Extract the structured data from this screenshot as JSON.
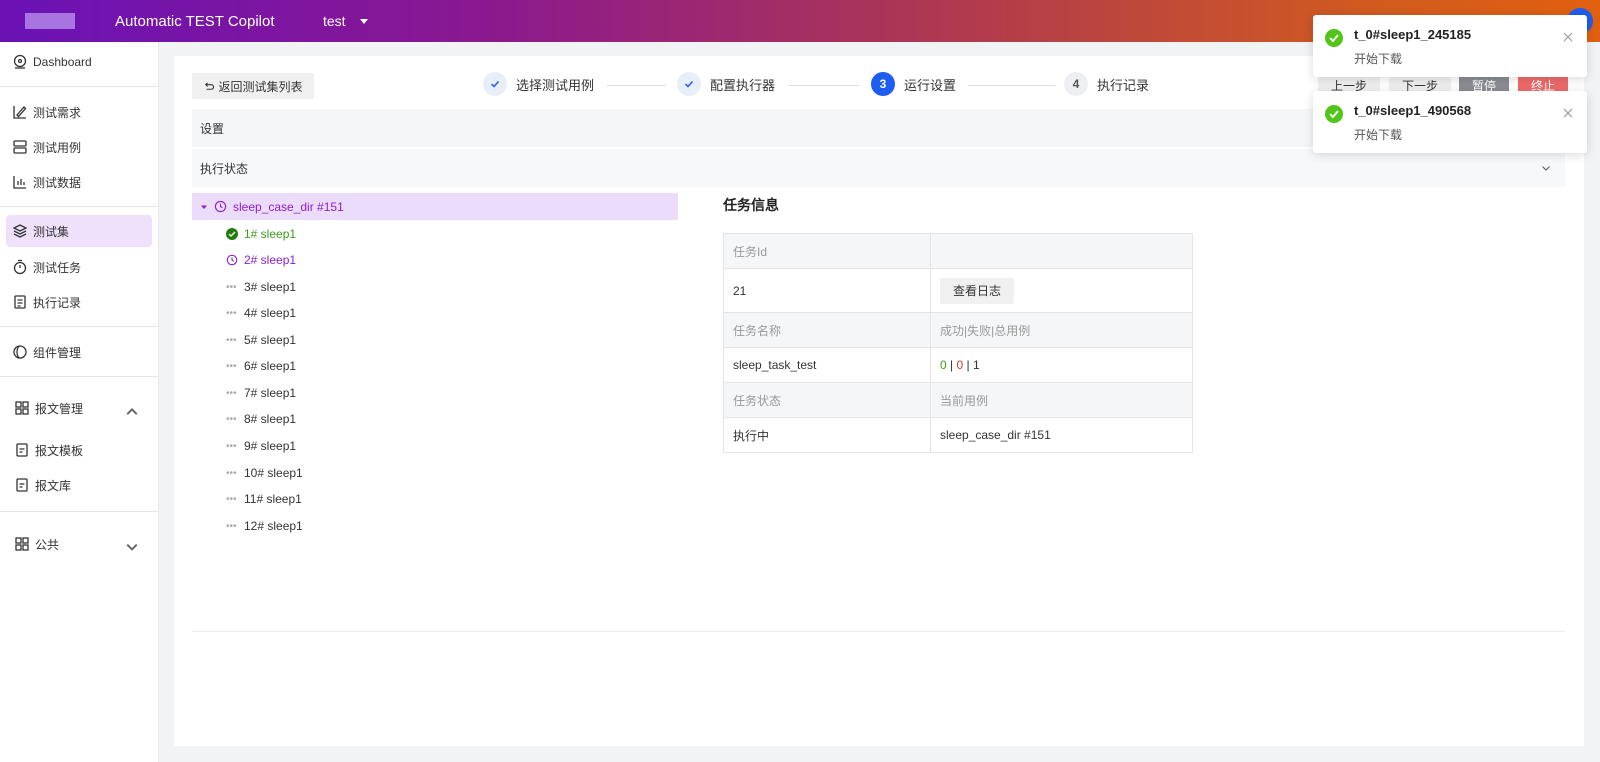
{
  "header": {
    "app_title": "Automatic TEST Copilot",
    "project": "test"
  },
  "sidebar": {
    "items": [
      {
        "label": "Dashboard",
        "icon": "dashboard-icon"
      },
      {
        "label": "测试需求",
        "icon": "requirement-icon"
      },
      {
        "label": "测试用例",
        "icon": "case-icon"
      },
      {
        "label": "测试数据",
        "icon": "data-icon"
      },
      {
        "label": "测试集",
        "icon": "layers-icon"
      },
      {
        "label": "测试任务",
        "icon": "timer-icon"
      },
      {
        "label": "执行记录",
        "icon": "record-icon"
      },
      {
        "label": "组件管理",
        "icon": "component-icon"
      },
      {
        "label": "报文管理",
        "icon": "grid-icon"
      },
      {
        "label": "报文模板",
        "icon": "doc-icon"
      },
      {
        "label": "报文库",
        "icon": "doc-icon"
      },
      {
        "label": "公共",
        "icon": "grid-icon"
      }
    ]
  },
  "toolbar": {
    "back_label": "返回测试集列表",
    "prev_label": "上一步",
    "next_label": "下一步",
    "pause_label": "暂停",
    "stop_label": "终止"
  },
  "steps": [
    {
      "num": "",
      "label": "选择测试用例",
      "state": "done"
    },
    {
      "num": "",
      "label": "配置执行器",
      "state": "done"
    },
    {
      "num": "3",
      "label": "运行设置",
      "state": "current"
    },
    {
      "num": "4",
      "label": "执行记录",
      "state": "pending"
    }
  ],
  "panels": {
    "settings": "设置",
    "status": "执行状态"
  },
  "tree": {
    "root": "sleep_case_dir #151",
    "items": [
      {
        "label": "1# sleep1",
        "state": "success"
      },
      {
        "label": "2# sleep1",
        "state": "running"
      },
      {
        "label": "3# sleep1",
        "state": "pending"
      },
      {
        "label": "4# sleep1",
        "state": "pending"
      },
      {
        "label": "5# sleep1",
        "state": "pending"
      },
      {
        "label": "6# sleep1",
        "state": "pending"
      },
      {
        "label": "7# sleep1",
        "state": "pending"
      },
      {
        "label": "8# sleep1",
        "state": "pending"
      },
      {
        "label": "9# sleep1",
        "state": "pending"
      },
      {
        "label": "10# sleep1",
        "state": "pending"
      },
      {
        "label": "11# sleep1",
        "state": "pending"
      },
      {
        "label": "12# sleep1",
        "state": "pending"
      }
    ]
  },
  "task_info": {
    "title": "任务信息",
    "id_header": "任务Id",
    "id_value": "21",
    "log_button": "查看日志",
    "name_header": "任务名称",
    "result_header": "成功|失败|总用例",
    "name_value": "sleep_task_test",
    "success": "0",
    "fail": "0",
    "total": "1",
    "sep": "|",
    "status_header": "任务状态",
    "current_header": "当前用例",
    "status_value": "执行中",
    "current_value": "sleep_case_dir #151"
  },
  "toasts": [
    {
      "title": "t_0#sleep1_245185",
      "message": "开始下载"
    },
    {
      "title": "t_0#sleep1_490568",
      "message": "开始下载"
    }
  ],
  "colors": {
    "accent": "#1e5df0",
    "active_nav": "#efe0fb",
    "success": "#3a9b1a",
    "fail": "#d0382e",
    "running": "#8b1fd0"
  }
}
